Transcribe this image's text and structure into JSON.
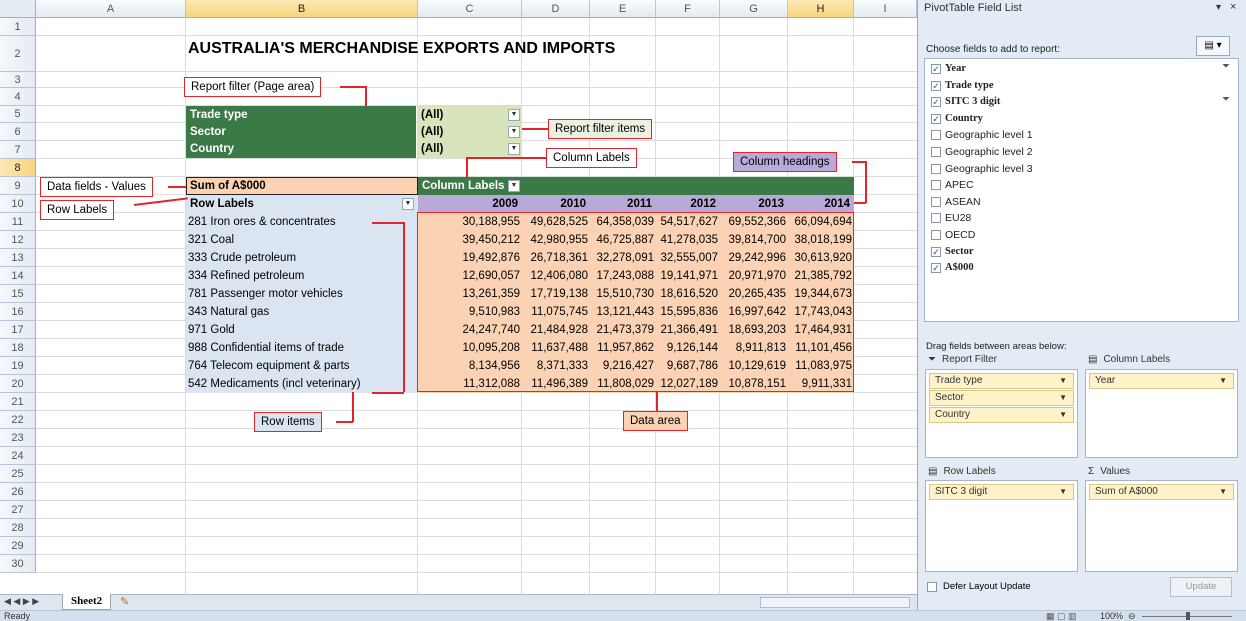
{
  "columns": [
    "A",
    "B",
    "C",
    "D",
    "E",
    "F",
    "G",
    "H",
    "I"
  ],
  "rows": [
    "1",
    "2",
    "3",
    "4",
    "5",
    "6",
    "7",
    "8",
    "9",
    "10",
    "11",
    "12",
    "13",
    "14",
    "15",
    "16",
    "17",
    "18",
    "19",
    "20",
    "21",
    "22",
    "23",
    "24",
    "25",
    "26",
    "27",
    "28",
    "29",
    "30"
  ],
  "title": "AUSTRALIA'S MERCHANDISE EXPORTS AND IMPORTS",
  "filters": [
    {
      "label": "Trade type",
      "value": "(All)"
    },
    {
      "label": "Sector",
      "value": "(All)"
    },
    {
      "label": "Country",
      "value": "(All)"
    }
  ],
  "pivot": {
    "sum_label": "Sum of A$000",
    "column_labels": "Column Labels",
    "row_labels": "Row Labels",
    "years": [
      "2009",
      "2010",
      "2011",
      "2012",
      "2013",
      "2014"
    ],
    "rows": [
      {
        "label": "281 Iron ores & concentrates",
        "values": [
          "30,188,955",
          "49,628,525",
          "64,358,039",
          "54,517,627",
          "69,552,366",
          "66,094,694"
        ]
      },
      {
        "label": "321 Coal",
        "values": [
          "39,450,212",
          "42,980,955",
          "46,725,887",
          "41,278,035",
          "39,814,700",
          "38,018,199"
        ]
      },
      {
        "label": "333 Crude petroleum",
        "values": [
          "19,492,876",
          "26,718,361",
          "32,278,091",
          "32,555,007",
          "29,242,996",
          "30,613,920"
        ]
      },
      {
        "label": "334 Refined petroleum",
        "values": [
          "12,690,057",
          "12,406,080",
          "17,243,088",
          "19,141,971",
          "20,971,970",
          "21,385,792"
        ]
      },
      {
        "label": "781 Passenger motor vehicles",
        "values": [
          "13,261,359",
          "17,719,138",
          "15,510,730",
          "18,616,520",
          "20,265,435",
          "19,344,673"
        ]
      },
      {
        "label": "343 Natural gas",
        "values": [
          "9,510,983",
          "11,075,745",
          "13,121,443",
          "15,595,836",
          "16,997,642",
          "17,743,043"
        ]
      },
      {
        "label": "971 Gold",
        "values": [
          "24,247,740",
          "21,484,928",
          "21,473,379",
          "21,366,491",
          "18,693,203",
          "17,464,931"
        ]
      },
      {
        "label": "988 Confidential items of trade",
        "values": [
          "10,095,208",
          "11,637,488",
          "11,957,862",
          "9,126,144",
          "8,911,813",
          "11,101,456"
        ]
      },
      {
        "label": "764 Telecom equipment & parts",
        "values": [
          "8,134,956",
          "8,371,333",
          "9,216,427",
          "9,687,786",
          "10,129,619",
          "11,083,975"
        ]
      },
      {
        "label": "542 Medicaments (incl veterinary)",
        "values": [
          "11,312,088",
          "11,496,389",
          "11,808,029",
          "12,027,189",
          "10,878,151",
          "9,911,331"
        ]
      }
    ]
  },
  "callouts": {
    "report_filter": "Report filter (Page area)",
    "filter_items": "Report filter items",
    "column_labels": "Column Labels",
    "column_headings": "Column headings",
    "data_fields": "Data fields - Values",
    "row_labels": "Row Labels",
    "row_items": "Row items",
    "data_area": "Data area"
  },
  "sheet_tab": "Sheet2",
  "status": {
    "ready": "Ready",
    "zoom": "100%"
  },
  "panel": {
    "title": "PivotTable Field List",
    "choose": "Choose fields to add to report:",
    "fields": [
      {
        "name": "Year",
        "checked": true,
        "bold": true,
        "filter": true
      },
      {
        "name": "Trade type",
        "checked": true,
        "bold": true,
        "filter": false
      },
      {
        "name": "SITC 3 digit",
        "checked": true,
        "bold": true,
        "filter": true
      },
      {
        "name": "Country",
        "checked": true,
        "bold": true,
        "filter": false
      },
      {
        "name": "Geographic level 1",
        "checked": false,
        "bold": false,
        "filter": false
      },
      {
        "name": "Geographic level 2",
        "checked": false,
        "bold": false,
        "filter": false
      },
      {
        "name": "Geographic level 3",
        "checked": false,
        "bold": false,
        "filter": false
      },
      {
        "name": "APEC",
        "checked": false,
        "bold": false,
        "filter": false
      },
      {
        "name": "ASEAN",
        "checked": false,
        "bold": false,
        "filter": false
      },
      {
        "name": "EU28",
        "checked": false,
        "bold": false,
        "filter": false
      },
      {
        "name": "OECD",
        "checked": false,
        "bold": false,
        "filter": false
      },
      {
        "name": "Sector",
        "checked": true,
        "bold": true,
        "filter": false
      },
      {
        "name": "A$000",
        "checked": true,
        "bold": true,
        "filter": false
      }
    ],
    "drag_label": "Drag fields between areas below:",
    "report_filter_label": "Report Filter",
    "column_labels_label": "Column Labels",
    "row_labels_label": "Row Labels",
    "values_label": "Values",
    "report_filter_items": [
      "Trade type",
      "Sector",
      "Country"
    ],
    "column_items": [
      "Year"
    ],
    "row_items": [
      "SITC 3 digit"
    ],
    "value_items": [
      "Sum of A$000"
    ],
    "defer": "Defer Layout Update",
    "update": "Update"
  },
  "colors": {
    "green": "#3b7a46",
    "peach": "#fbd3b4",
    "lightblue": "#dbe5f1",
    "lavender": "#b8a9d9",
    "callout_red": "#e0262c"
  }
}
